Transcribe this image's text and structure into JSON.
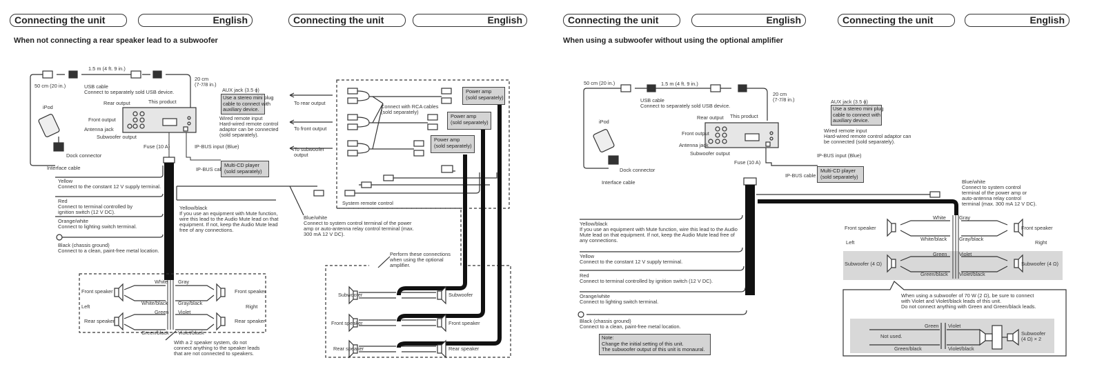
{
  "headers": [
    {
      "left": "Connecting the unit",
      "right": "English"
    },
    {
      "left": "Connecting the unit",
      "right": "English"
    },
    {
      "left": "Connecting the unit",
      "right": "English"
    },
    {
      "left": "Connecting the unit",
      "right": "English"
    }
  ],
  "left_diagram": {
    "subtitle": "When not connecting a rear speaker lead to a subwoofer",
    "cable_50cm": "50 cm (20 in.)",
    "cable_15m": "1.5 m (4 ft. 9 in.)",
    "usb_cable": "USB cable",
    "usb_note": "Connect to separately sold USB device.",
    "cable_20cm_1": "20 cm",
    "cable_20cm_2": "(7-7/8 in.)",
    "ipod": "iPod",
    "dock_connector": "Dock connector",
    "interface_cable": "Interface cable",
    "rear_output": "Rear output",
    "this_product": "This product",
    "front_output": "Front output",
    "antenna_jack": "Antenna jack",
    "subwoofer_output": "Subwoofer output",
    "fuse": "Fuse (10 A)",
    "ipbus_input": "IP-BUS input (Blue)",
    "aux_jack": "AUX jack (3.5 ϕ)",
    "aux_note": [
      "Use a stereo mini plug",
      "cable to connect with",
      "auxiliary device."
    ],
    "wired_remote": "Wired remote input",
    "wired_remote_note": [
      "Hard-wired remote control",
      "adaptor can be connected",
      "(sold separately)."
    ],
    "ipbus_cable": "IP-BUS cable",
    "multi_cd": [
      "Multi-CD player",
      "(sold separately)"
    ],
    "yellow": "Yellow",
    "yellow_note": "Connect to the constant 12 V supply terminal.",
    "red": "Red",
    "red_note": [
      "Connect to terminal controlled by",
      "ignition switch (12 V DC)."
    ],
    "orange": "Orange/white",
    "orange_note": "Connect to lighting switch terminal.",
    "black": "Black (chassis ground)",
    "black_note": "Connect to a clean, paint-free metal location.",
    "yellow_black": "Yellow/black",
    "yellow_black_note": [
      "If you use an equipment with Mute function,",
      "wire this lead to the Audio Mute lead on that",
      "equipment. If not, keep the Audio Mute lead",
      "free of any connections."
    ],
    "blue_white": "Blue/white",
    "blue_white_note": [
      "Connect to system control terminal of the power",
      "amp or auto-antenna relay control terminal (max.",
      "300 mA 12 V DC)."
    ],
    "speakers": {
      "front_speaker": "Front speaker",
      "rear_speaker": "Rear speaker",
      "left": "Left",
      "right": "Right",
      "white": "White",
      "white_black": "White/black",
      "gray": "Gray",
      "gray_black": "Gray/black",
      "green": "Green",
      "green_black": "Green/black",
      "violet": "Violet",
      "violet_black": "Violet/black",
      "two_speaker_note": [
        "With a 2 speaker system, do not",
        "connect anything to the speaker leads",
        "that are not connected to speakers."
      ]
    },
    "amp_section": {
      "to_rear": "To rear output",
      "to_front": "To front output",
      "to_sub_1": "To subwoofer",
      "to_sub_2": "output",
      "rca_note": [
        "Connect with RCA cables",
        "(sold separately)"
      ],
      "power_amp": [
        "Power amp",
        "(sold separately)"
      ],
      "system_remote": "System remote control",
      "perform_note": [
        "Perform these connections",
        "when using the optional",
        "amplifier."
      ],
      "subwoofer": "Subwoofer",
      "front_speaker": "Front speaker",
      "rear_speaker": "Rear speaker"
    }
  },
  "right_diagram": {
    "subtitle": "When using a subwoofer without using the optional amplifier",
    "cable_50cm": "50 cm (20 in.)",
    "cable_15m": "1.5 m (4 ft. 9 in.)",
    "usb_cable": "USB cable",
    "usb_note": "Connect to separately sold USB device.",
    "cable_20cm_1": "20 cm",
    "cable_20cm_2": "(7-7/8 in.)",
    "ipod": "iPod",
    "dock_connector": "Dock connector",
    "interface_cable": "Interface cable",
    "rear_output": "Rear output",
    "this_product": "This product",
    "front_output": "Front output",
    "antenna_jack": "Antenna jack",
    "subwoofer_output": "Subwoofer output",
    "fuse": "Fuse (10 A)",
    "ipbus_input": "IP-BUS input (Blue)",
    "aux_jack": "AUX jack (3.5 ϕ)",
    "aux_note": [
      "Use a stereo mini plug",
      "cable to connect with",
      "auxiliary device."
    ],
    "wired_remote": "Wired remote input",
    "wired_remote_note": [
      "Hard-wired remote control adaptor can",
      "be connected (sold separately)."
    ],
    "ipbus_cable": "IP-BUS cable",
    "multi_cd": [
      "Multi-CD player",
      "(sold separately)"
    ],
    "blue_white": "Blue/white",
    "blue_white_note": [
      "Connect to system control",
      "terminal of the power amp or",
      "auto-antenna relay control",
      "terminal (max. 300 mA 12 V DC)."
    ],
    "yellow_black": "Yellow/black",
    "yellow_black_note": [
      "If you use an equipment with Mute function, wire this lead to the Audio",
      "Mute lead on that equipment. If not, keep the Audio Mute lead free of",
      "any connections."
    ],
    "yellow": "Yellow",
    "yellow_note": "Connect to the constant 12 V supply terminal.",
    "red": "Red",
    "red_note": "Connect to terminal controlled by ignition switch (12 V DC).",
    "orange": "Orange/white",
    "orange_note": "Connect to lighting switch terminal.",
    "black": "Black (chassis ground)",
    "black_note": "Connect to a clean, paint-free metal location.",
    "note_box": [
      "Note:",
      "Change the initial setting of this unit.",
      "The subwoofer output of this unit is monaural."
    ],
    "speakers": {
      "front_speaker": "Front speaker",
      "subwoofer_4ohm": "Subwoofer (4 Ω)",
      "left": "Left",
      "right": "Right",
      "white": "White",
      "white_black": "White/black",
      "gray": "Gray",
      "gray_black": "Gray/black",
      "green": "Green",
      "green_black": "Green/black",
      "violet": "Violet",
      "violet_black": "Violet/black"
    },
    "callout": {
      "text": [
        "When using a subwoofer of 70 W (2 Ω), be sure to connect",
        "with Violet and Violet/black leads of this unit.",
        "Do not connect anything with Green and Green/black leads."
      ],
      "not_used": "Not used.",
      "green": "Green",
      "violet": "Violet",
      "green_black": "Green/black",
      "violet_black": "Violet/black",
      "subwoofer_1": "Subwoofer",
      "subwoofer_2": "(4 Ω) × 2"
    }
  }
}
